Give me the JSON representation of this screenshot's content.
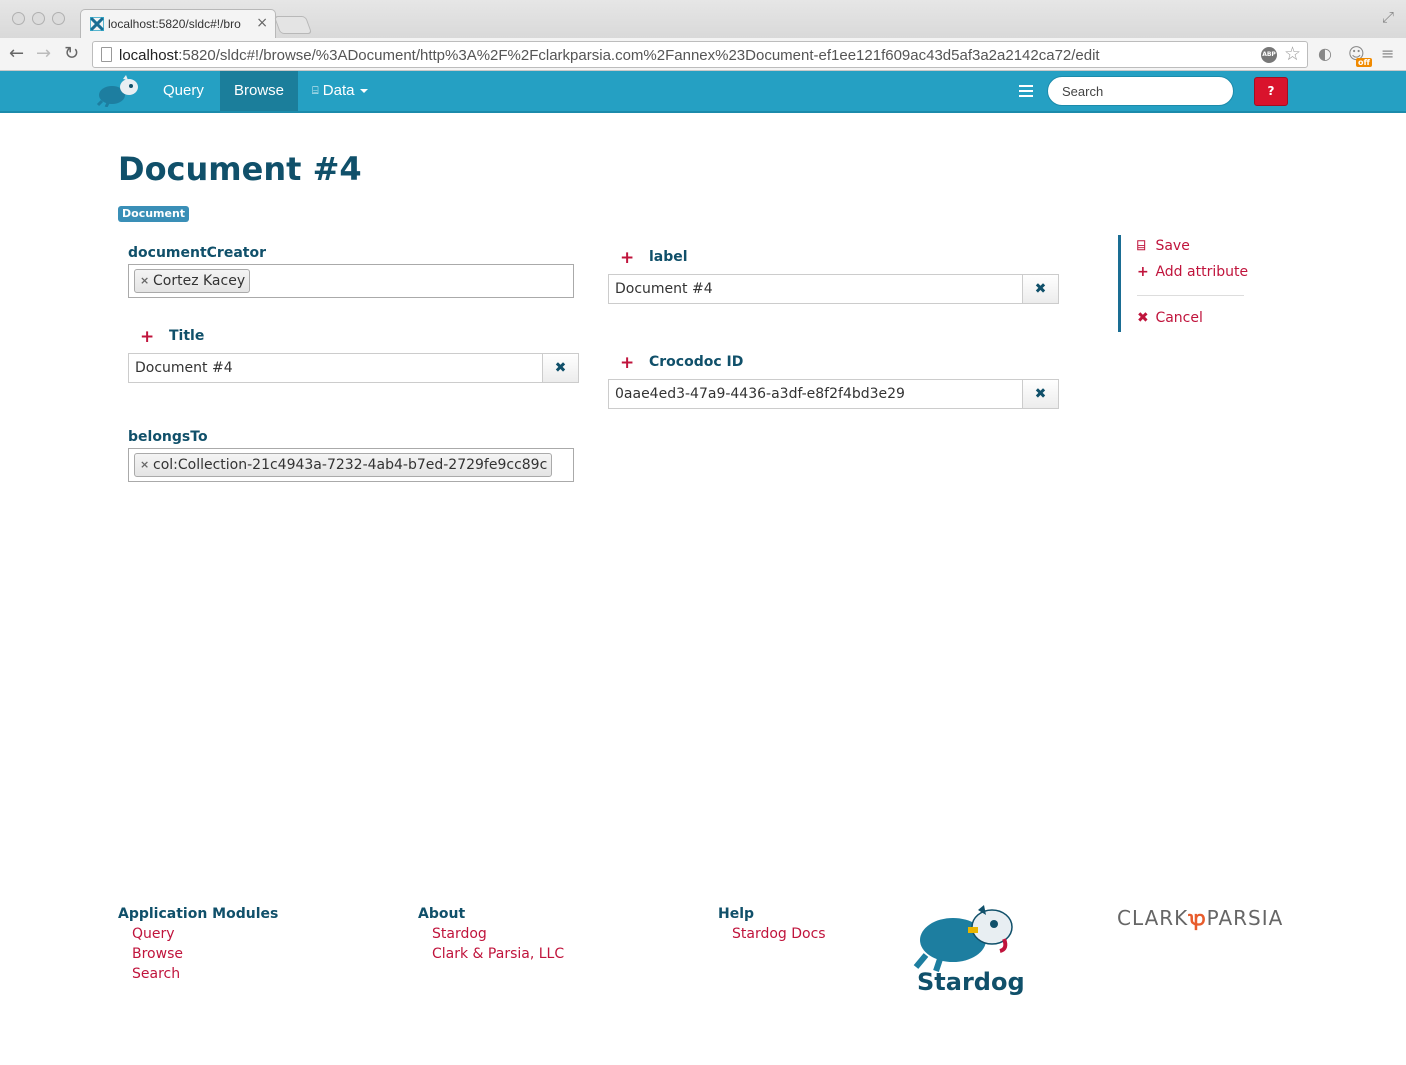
{
  "browser": {
    "tab_title": "localhost:5820/sldc#!/bro",
    "url_host": "localhost",
    "url_path": ":5820/sldc#!/browse/%3ADocument/http%3A%2F%2Fclarkparsia.com%2Fannex%23Document-ef1ee121f609ac43d5af3a2a2142ca72/edit",
    "extension_badge": "off"
  },
  "nav": {
    "items": [
      {
        "label": "Query"
      },
      {
        "label": "Browse"
      },
      {
        "label": "Data"
      }
    ],
    "search_placeholder": "Search",
    "help_label": "?"
  },
  "page": {
    "title": "Document #4",
    "type_badge": "Document"
  },
  "fields": {
    "documentCreator": {
      "label": "documentCreator",
      "tag": "Cortez Kacey"
    },
    "title": {
      "label": "Title",
      "value": "Document #4"
    },
    "belongsTo": {
      "label": "belongsTo",
      "tag": "col:Collection-21c4943a-7232-4ab4-b7ed-2729fe9cc89c"
    },
    "label": {
      "label": "label",
      "value": "Document #4"
    },
    "crocodoc": {
      "label": "Crocodoc ID",
      "value": "0aae4ed3-47a9-4436-a3df-e8f2f4bd3e29"
    }
  },
  "actions": {
    "save": "Save",
    "add_attribute": "Add attribute",
    "cancel": "Cancel"
  },
  "footer": {
    "modules_heading": "Application Modules",
    "modules": [
      "Query",
      "Browse",
      "Search"
    ],
    "about_heading": "About",
    "about": [
      "Stardog",
      "Clark & Parsia, LLC"
    ],
    "help_heading": "Help",
    "help": [
      "Stardog Docs"
    ],
    "stardog_wordmark": "Stardog",
    "cp_left": "CLARK",
    "cp_right": "PARSIA"
  },
  "colors": {
    "navbar": "#25a0c3",
    "heading": "#10506a",
    "link": "#c0143c",
    "help_button": "#d9132c"
  }
}
